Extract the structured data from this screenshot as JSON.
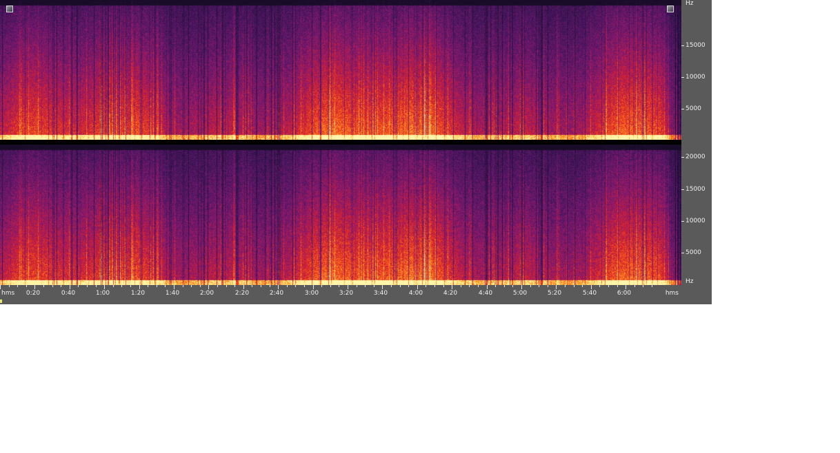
{
  "freq_axis": {
    "unit_top": "Hz",
    "unit_bottom": "Hz",
    "channel1_labels": [
      "15000",
      "10000",
      "5000"
    ],
    "channel2_labels": [
      "20000",
      "15000",
      "10000",
      "5000"
    ]
  },
  "time_axis": {
    "start_label": "hms",
    "end_label": "hms",
    "labels": [
      "0:20",
      "0:40",
      "1:00",
      "1:20",
      "1:40",
      "2:00",
      "2:20",
      "2:40",
      "3:00",
      "3:20",
      "3:40",
      "4:00",
      "4:20",
      "4:40",
      "5:00",
      "5:20",
      "5:40",
      "6:00"
    ]
  },
  "colors": {
    "spec_dark": "#20122e",
    "spec_purple": "#6a1f7a",
    "spec_red": "#d8202a",
    "spec_orange": "#ff7a18",
    "spec_yellow": "#ffe36a",
    "axis_bg": "#5a5a5a"
  }
}
